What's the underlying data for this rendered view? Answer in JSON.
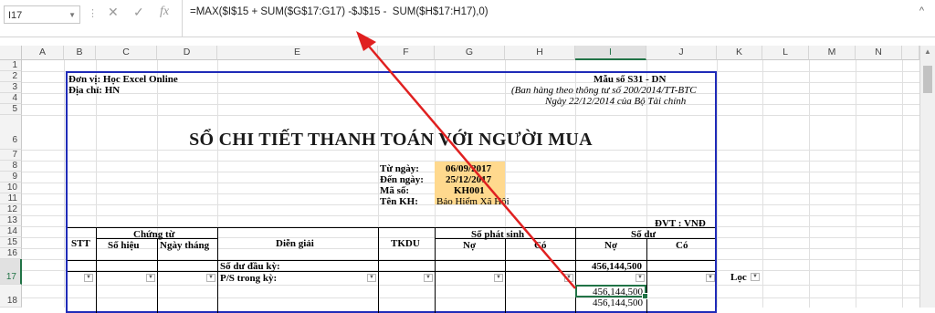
{
  "formula_bar": {
    "name_box": "I17",
    "formula": "=MAX($I$15 + SUM($G$17:G17) -$J$15 -  SUM($H$17:H17),0)"
  },
  "columns": [
    "A",
    "B",
    "C",
    "D",
    "E",
    "F",
    "G",
    "H",
    "I",
    "J",
    "K",
    "L",
    "M",
    "N"
  ],
  "selected_column": "I",
  "rows": [
    "1",
    "2",
    "3",
    "4",
    "5",
    "6",
    "7",
    "8",
    "9",
    "10",
    "11",
    "12",
    "13",
    "14",
    "15",
    "16",
    "17",
    "18"
  ],
  "selected_row": "17",
  "sheet": {
    "unit_label": "Đơn vị: Học Excel Online",
    "address_label": "Địa chỉ: HN",
    "form_no": "Mẫu số S31 - DN",
    "circular": "(Ban hàng theo thông tư số 200/2014/TT-BTC",
    "date_note": "Ngày 22/12/2014 của Bộ Tài chính",
    "title": "SỔ CHI TIẾT THANH TOÁN VỚI NGƯỜI MUA",
    "from_label": "Từ ngày:",
    "from_value": "06/09/2017",
    "to_label": "Đến ngày:",
    "to_value": "25/12/2017",
    "code_label": "Mã số:",
    "code_value": "KH001",
    "name_label": "Tên KH:",
    "name_value": "Bảo Hiểm Xã Hội",
    "currency": "ĐVT : VNĐ",
    "hdr_stt": "STT",
    "hdr_voucher": "Chứng từ",
    "hdr_voucher_no": "Số hiệu",
    "hdr_voucher_date": "Ngày tháng",
    "hdr_desc": "Diễn giải",
    "hdr_account": "TKDU",
    "hdr_arising": "Số phát sinh",
    "hdr_balance": "Số dư",
    "hdr_debit": "Nợ",
    "hdr_credit": "Có",
    "hdr_debit2": "Nợ",
    "hdr_credit2": "Có",
    "opening_label": "Số dư đầu kỳ:",
    "opening_value": "456,144,500",
    "period_label": "P/S trong kỳ:",
    "filter_label": "Lọc",
    "row17_value": "456,144,500",
    "row18_value": "456,144,500"
  },
  "colors": {
    "border": "#1f2bb8",
    "highlight": "#ffd98e",
    "excel_green": "#217346",
    "arrow": "#e02020"
  }
}
